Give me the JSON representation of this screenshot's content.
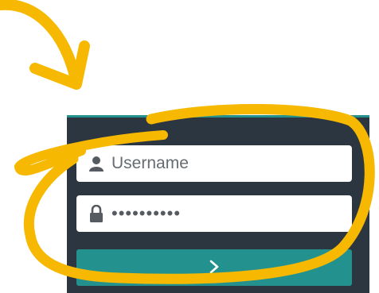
{
  "login": {
    "username": {
      "placeholder": "Username",
      "value": "",
      "icon": "user-icon"
    },
    "password": {
      "value": "••••••••••",
      "icon": "lock-icon"
    },
    "submit": {
      "icon": "chevron-right-icon"
    }
  },
  "colors": {
    "panel": "#2b3640",
    "accent": "#23928f",
    "annotation": "#f6b800"
  }
}
